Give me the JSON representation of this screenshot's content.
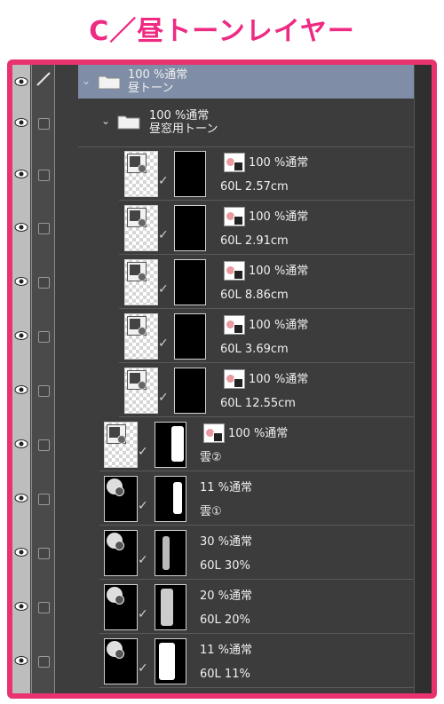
{
  "heading": "C／昼トーンレイヤー",
  "folders": [
    {
      "opacity": "100 %通常",
      "name": "昼トーン"
    },
    {
      "opacity": "100 %通常",
      "name": "昼窓用トーン"
    }
  ],
  "tone_layers": [
    {
      "opacity": "100 %通常",
      "name": "60L 2.57cm"
    },
    {
      "opacity": "100 %通常",
      "name": "60L 2.91cm"
    },
    {
      "opacity": "100 %通常",
      "name": "60L 8.86cm"
    },
    {
      "opacity": "100 %通常",
      "name": "60L 3.69cm"
    },
    {
      "opacity": "100 %通常",
      "name": "60L 12.55cm"
    }
  ],
  "cloud_tone": {
    "opacity": "100 %通常",
    "name": "雲②"
  },
  "other_layers": [
    {
      "opacity": "11 %通常",
      "name": "雲①"
    },
    {
      "opacity": "30 %通常",
      "name": "60L 30%"
    },
    {
      "opacity": "20 %通常",
      "name": "60L 20%"
    },
    {
      "opacity": "11 %通常",
      "name": "60L 11%"
    }
  ],
  "icons": {
    "visibility": "eye-icon",
    "lock": "checkbox-icon",
    "edit": "pen-icon",
    "folder": "folder-icon",
    "expand": "chevron-down-icon",
    "tone": "tone-icon",
    "mask_link": "check-icon"
  },
  "colors": {
    "accent": "#ee2a82",
    "frame": "#e8336e",
    "panel": "#3d3d3d",
    "selected": "#7f8ea6"
  }
}
